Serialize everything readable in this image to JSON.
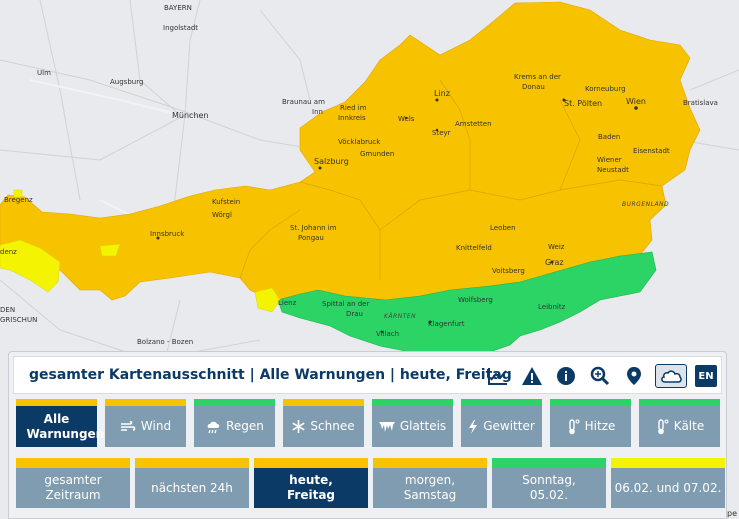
{
  "colors": {
    "orange": "#f7c200",
    "green": "#2bd465",
    "yellow": "#f4f400",
    "navy": "#0b3a66",
    "button": "#7f9cb0"
  },
  "map": {
    "countries": {
      "italy_swiss": "GRISCHUN",
      "italy_south": "ONDEN"
    },
    "cities_de": [
      "Bayern",
      "Ingolstadt",
      "Ulm",
      "Augsburg",
      "München",
      "Bregenz",
      "Kufstein",
      "Wörgl",
      "Innsbruck",
      "Bolzano - Bozen"
    ],
    "cities_at": [
      "Braunau am Inn",
      "Ried im Innkreis",
      "Linz",
      "Wels",
      "Steyr",
      "Amstetten",
      "Krems an der Donau",
      "Korneuburg",
      "St. Pölten",
      "Wien",
      "Bratislava",
      "Vöcklabruck",
      "Gmunden",
      "Salzburg",
      "Baden",
      "Eisenstadt",
      "Wiener Neustadt",
      "St. Johann im Pongau",
      "Leoben",
      "Knittelfeld",
      "Weiz",
      "Graz",
      "Voitsberg",
      "Wolfsberg",
      "Leibnitz",
      "Spittal an der Drau",
      "Lienz",
      "Villach",
      "Klagenfurt"
    ],
    "regions": {
      "burgenland": "BURGENLAND",
      "kaernten": "KÄRNTEN"
    },
    "attribution": "© Ope"
  },
  "panel": {
    "title": "gesamter Kartenausschnitt | Alle Warnungen | heute, Freitag",
    "toolbar": [
      {
        "name": "chart-icon"
      },
      {
        "name": "warning-icon"
      },
      {
        "name": "info-icon"
      },
      {
        "name": "zoom-search-icon"
      },
      {
        "name": "location-pin-icon"
      },
      {
        "name": "cloud-layer-icon"
      },
      {
        "name": "language-button",
        "label": "EN"
      }
    ],
    "types": [
      {
        "label": "Alle Warnungen",
        "icon": "all-icon",
        "level": "orange",
        "active": true
      },
      {
        "label": "Wind",
        "icon": "wind-icon",
        "level": "orange",
        "active": false
      },
      {
        "label": "Regen",
        "icon": "rain-icon",
        "level": "green",
        "active": false
      },
      {
        "label": "Schnee",
        "icon": "snow-icon",
        "level": "orange",
        "active": false
      },
      {
        "label": "Glatteis",
        "icon": "ice-icon",
        "level": "green",
        "active": false
      },
      {
        "label": "Gewitter",
        "icon": "thunder-icon",
        "level": "green",
        "active": false
      },
      {
        "label": "Hitze",
        "icon": "heat-icon",
        "level": "green",
        "active": false
      },
      {
        "label": "Kälte",
        "icon": "cold-icon",
        "level": "green",
        "active": false
      }
    ],
    "periods": [
      {
        "label": "gesamter Zeitraum",
        "level": "orange",
        "active": false
      },
      {
        "label": "nächsten 24h",
        "level": "orange",
        "active": false
      },
      {
        "label": "heute, Freitag",
        "level": "orange",
        "active": true
      },
      {
        "label": "morgen, Samstag",
        "level": "orange",
        "active": false
      },
      {
        "label": "Sonntag, 05.02.",
        "level": "green",
        "active": false
      },
      {
        "label": "06.02. und 07.02.",
        "level": "yellow",
        "active": false
      }
    ]
  }
}
